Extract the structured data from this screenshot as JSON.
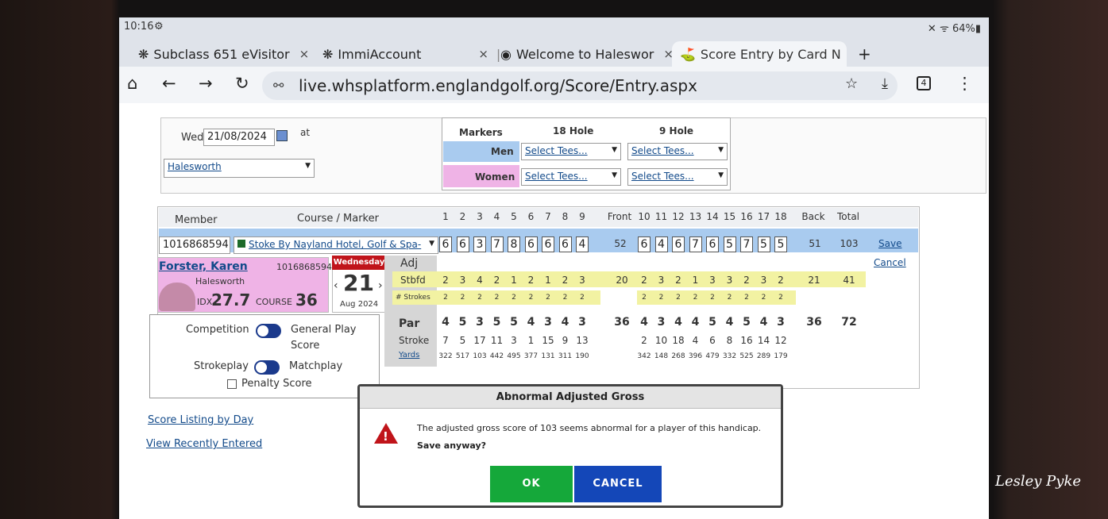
{
  "status": {
    "time": "10:16",
    "icons": "⚙",
    "right": "✕ ᯤ 64%▮"
  },
  "tabs": [
    {
      "icon": "❋",
      "label": "Subclass 651 eVisitor",
      "close": "×"
    },
    {
      "icon": "❋",
      "label": "ImmiAccount",
      "close": "×"
    },
    {
      "icon": "◉",
      "label": "Welcome to Haleswor",
      "close": "×"
    },
    {
      "icon": "⛳",
      "label": "Score Entry by Card N",
      "close": "×"
    }
  ],
  "new_tab": "+",
  "toolbar": {
    "url": "live.whsplatform.englandgolf.org/Score/Entry.aspx",
    "tab_count": "4"
  },
  "date_panel": {
    "day": "Wed",
    "date": "21/08/2024",
    "at": "at",
    "club": "Halesworth"
  },
  "markers": {
    "header": [
      "Markers",
      "18 Hole",
      "9 Hole"
    ],
    "men_label": "Men",
    "women_label": "Women",
    "select_placeholder": "Select Tees..."
  },
  "grid": {
    "member_label": "Member",
    "course_label": "Course / Marker",
    "holes_front": [
      "1",
      "2",
      "3",
      "4",
      "5",
      "6",
      "7",
      "8",
      "9"
    ],
    "front_label": "Front",
    "holes_back": [
      "10",
      "11",
      "12",
      "13",
      "14",
      "15",
      "16",
      "17",
      "18"
    ],
    "back_label": "Back",
    "total_label": "Total",
    "member_id": "1016868594",
    "course_value": "Stoke By Nayland Hotel, Golf & Spa-",
    "scores_front": [
      "6",
      "6",
      "3",
      "7",
      "8",
      "6",
      "6",
      "6",
      "4"
    ],
    "front_total": "52",
    "scores_back": [
      "6",
      "4",
      "6",
      "7",
      "6",
      "5",
      "7",
      "5",
      "5"
    ],
    "back_total": "51",
    "grand_total": "103",
    "save_link": "Save",
    "cancel_link": "Cancel"
  },
  "player": {
    "name": "Forster, Karen",
    "id": "1016868594",
    "club": "Halesworth",
    "idx_label": "IDX",
    "idx": "27.7",
    "course_label": "COURSE",
    "course_hcp": "36",
    "cal_day": "Wednesday",
    "cal_date": "21",
    "cal_month": "Aug 2024"
  },
  "stats": {
    "adj_label": "Adj",
    "stbfd_label": "Stbfd",
    "stbfd_front": [
      "2",
      "3",
      "4",
      "2",
      "1",
      "2",
      "1",
      "2",
      "3"
    ],
    "stbfd_front_total": "20",
    "stbfd_back": [
      "2",
      "3",
      "2",
      "1",
      "3",
      "3",
      "2",
      "3",
      "2"
    ],
    "stbfd_back_total": "21",
    "stbfd_total": "41",
    "strokes_label": "# Strokes",
    "strokes_front": [
      "2",
      "2",
      "2",
      "2",
      "2",
      "2",
      "2",
      "2",
      "2"
    ],
    "strokes_back": [
      "2",
      "2",
      "2",
      "2",
      "2",
      "2",
      "2",
      "2",
      "2"
    ],
    "par_label": "Par",
    "par_front": [
      "4",
      "5",
      "3",
      "5",
      "5",
      "4",
      "3",
      "4",
      "3"
    ],
    "par_front_total": "36",
    "par_back": [
      "4",
      "3",
      "4",
      "4",
      "5",
      "4",
      "5",
      "4",
      "3"
    ],
    "par_back_total": "36",
    "par_total": "72",
    "stroke_label": "Stroke",
    "stroke_front": [
      "7",
      "5",
      "17",
      "11",
      "3",
      "1",
      "15",
      "9",
      "13"
    ],
    "stroke_back": [
      "2",
      "10",
      "18",
      "4",
      "6",
      "8",
      "16",
      "14",
      "12"
    ],
    "yards_label": "Yards",
    "yards_front": [
      "322",
      "517",
      "103",
      "442",
      "495",
      "377",
      "131",
      "311",
      "190"
    ],
    "yards_back": [
      "342",
      "148",
      "268",
      "396",
      "479",
      "332",
      "525",
      "289",
      "179"
    ]
  },
  "options": {
    "competition": "Competition",
    "general_play": "General Play",
    "score": "Score",
    "strokeplay": "Strokeplay",
    "matchplay": "Matchplay",
    "penalty": "Penalty Score"
  },
  "links": {
    "score_listing": "Score Listing by Day",
    "recent": "View Recently Entered"
  },
  "modal": {
    "title": "Abnormal Adjusted Gross",
    "message": "The adjusted gross score of 103 seems abnormal for a player of this handicap.",
    "question": "Save anyway?",
    "ok": "OK",
    "cancel": "CANCEL"
  },
  "watermark": "Lesley Pyke",
  "colors": {
    "ok": "#15a83a",
    "cancel": "#1447b8",
    "calendar_red": "#c0141a"
  }
}
